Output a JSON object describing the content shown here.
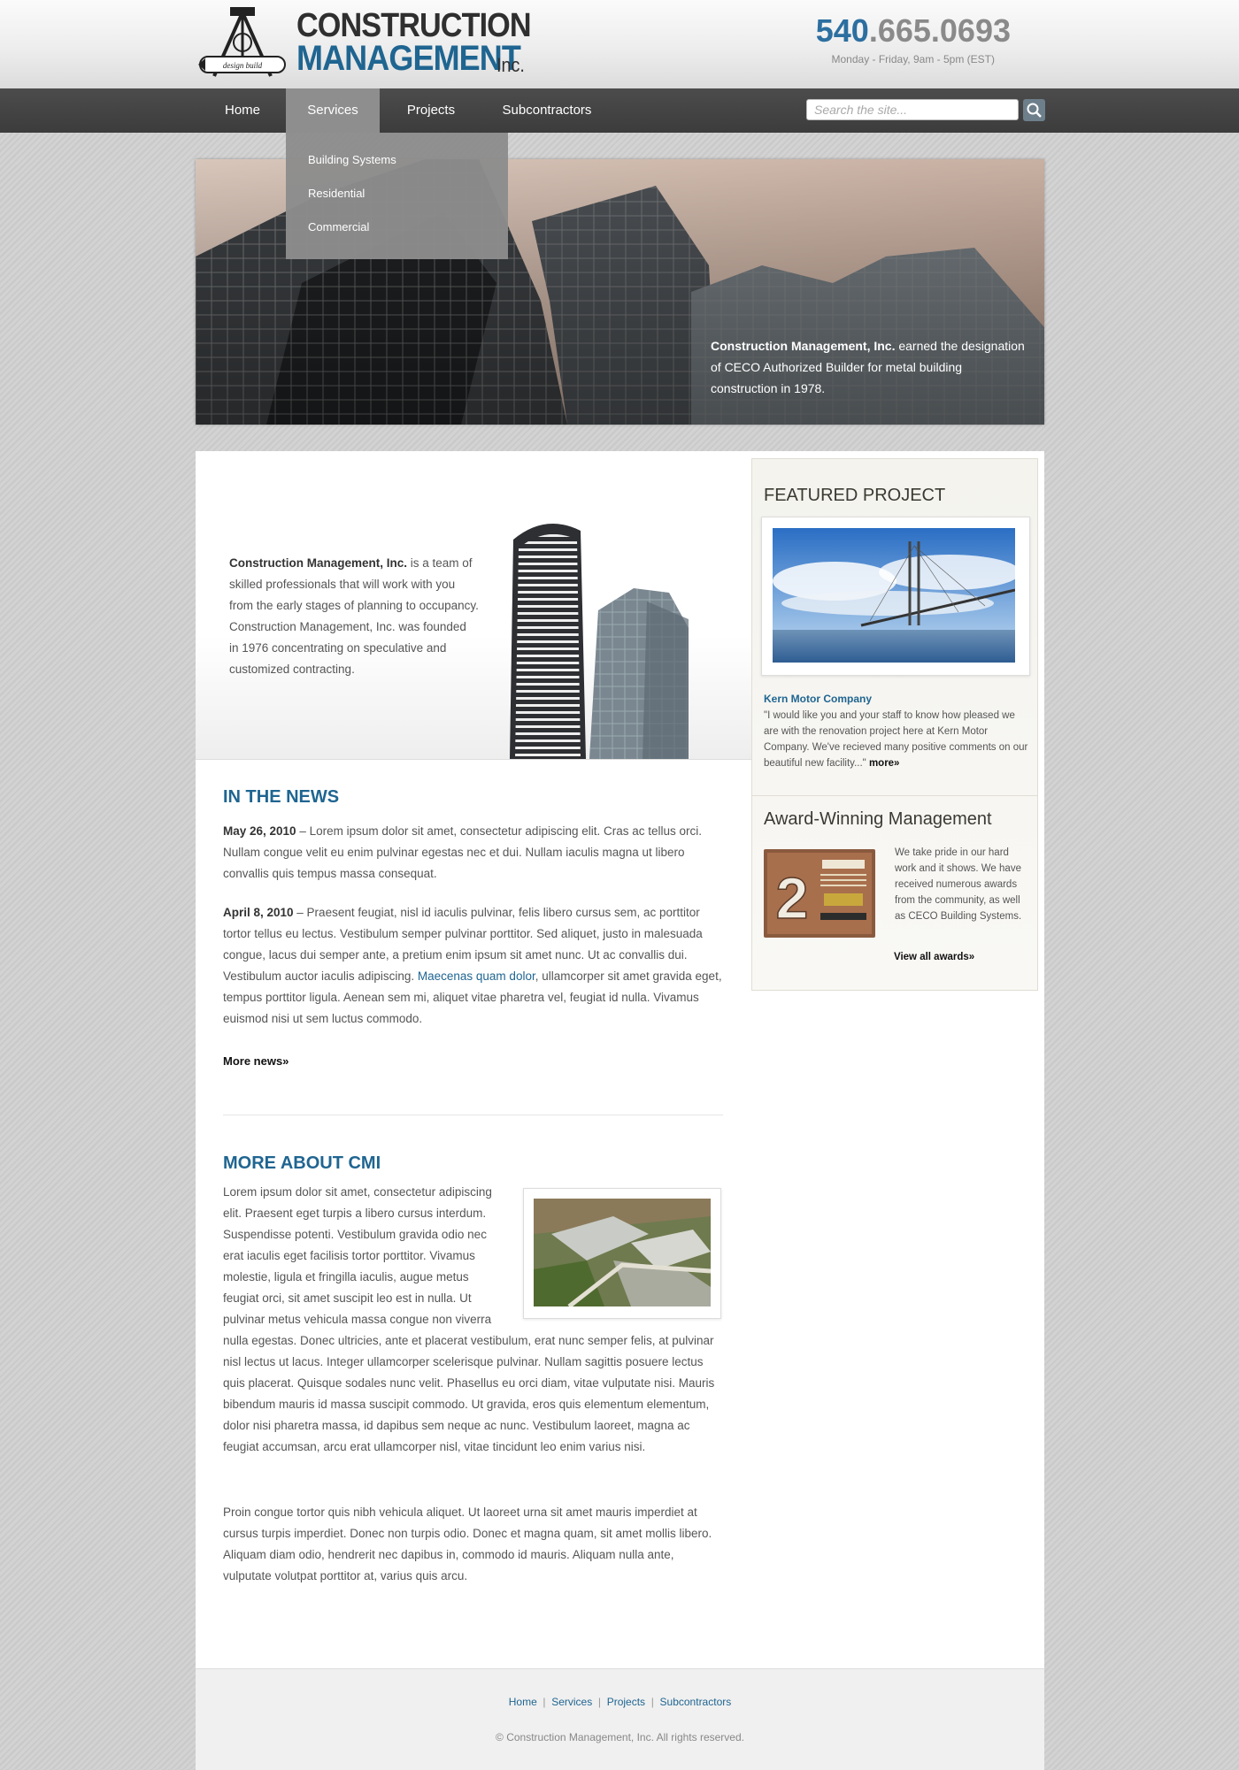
{
  "header": {
    "logo": {
      "line1": "CONSTRUCTION",
      "line2": "MANAGEMENT",
      "suffix": "Inc.",
      "tagline": "design build"
    },
    "phone": {
      "area": "540",
      "rest": ".665.0693"
    },
    "hours": "Monday - Friday, 9am - 5pm (EST)"
  },
  "nav": {
    "items": [
      "Home",
      "Services",
      "Projects",
      "Subcontractors"
    ],
    "active": "Services",
    "dropdown": [
      "Building Systems",
      "Residential",
      "Commercial"
    ],
    "search_placeholder": "Search the site..."
  },
  "hero": {
    "caption_bold": "Construction Management, Inc.",
    "caption_rest": " earned the designation of CECO Authorized Builder for metal building construction in 1978."
  },
  "intro": {
    "bold": "Construction Management, Inc.",
    "rest": " is a team of skilled professionals that will work with you from the early stages of planning to occupancy. Construction Management, Inc. was founded in 1976 concentrating on speculative and customized contracting."
  },
  "news": {
    "title": "IN THE NEWS",
    "items": [
      {
        "date": "May 26, 2010",
        "text": " – Lorem ipsum dolor sit amet, consectetur adipiscing elit. Cras ac tellus orci. Nullam congue velit eu enim pulvinar egestas nec et dui. Nullam iaculis magna ut libero convallis quis tempus massa consequat."
      },
      {
        "date": "April 8, 2010",
        "text_before": " – Praesent feugiat, nisl id iaculis pulvinar, felis libero cursus sem, ac porttitor tortor tellus eu lectus. Vestibulum semper pulvinar porttitor. Sed aliquet, justo in malesuada congue, lacus dui semper ante, a pretium enim ipsum sit amet nunc. Ut ac convallis dui. Vestibulum auctor iaculis adipiscing. ",
        "link": "Maecenas quam dolor",
        "text_after": ", ullamcorper sit amet gravida eget, tempus porttitor ligula. Aenean sem mi, aliquet vitae pharetra vel, feugiat id nulla. Vivamus euismod nisi ut sem luctus commodo."
      }
    ],
    "more": "More news»"
  },
  "about": {
    "title": "MORE ABOUT CMI",
    "p1": "Lorem ipsum dolor sit amet, consectetur adipiscing elit. Praesent eget turpis a libero cursus interdum. Suspendisse potenti. Vestibulum gravida odio nec erat iaculis eget facilisis tortor porttitor. Vivamus molestie, ligula et fringilla iaculis, augue metus feugiat orci, sit amet suscipit leo est in nulla. Ut pulvinar metus vehicula massa congue non viverra nulla egestas. Donec ultricies, ante et placerat vestibulum, erat nunc semper felis, at pulvinar nisl lectus ut lacus. Integer ullamcorper scelerisque pulvinar. Nullam sagittis posuere lectus quis placerat. Quisque sodales nunc velit. Phasellus eu orci diam, vitae vulputate nisi. Mauris bibendum mauris id massa suscipit commodo. Ut gravida, eros quis elementum elementum, dolor nisi pharetra massa, id dapibus sem neque ac nunc. Vestibulum laoreet, magna ac feugiat accumsan, arcu erat ullamcorper nisl, vitae tincidunt leo enim varius nisi.",
    "p2": "Proin congue tortor quis nibh vehicula aliquet. Ut laoreet urna sit amet mauris imperdiet at cursus turpis imperdiet. Donec non turpis odio. Donec et magna quam, sit amet mollis libero. Aliquam diam odio, hendrerit nec dapibus in, commodo id mauris. Aliquam nulla ante, vulputate volutpat porttitor at, varius quis arcu."
  },
  "sidebar": {
    "featured_title": "FEATURED PROJECT",
    "project_name": "Kern Motor Company",
    "quote": "\"I would like you and your staff to know how pleased we are with the renovation project here at Kern Motor Company.  We've recieved many positive comments on our beautiful new facility...\"",
    "quote_more": "more»",
    "award_title": "Award-Winning Management",
    "award_text": "We take pride in our hard work and it shows. We have received numerous awards from the community, as well as CECO Building Systems.",
    "award_number": "2",
    "award_link": "View all awards»"
  },
  "footer": {
    "links": [
      "Home",
      "Services",
      "Projects",
      "Subcontractors"
    ],
    "separator": "|",
    "copyright": "© Construction Management, Inc. All rights reserved."
  }
}
